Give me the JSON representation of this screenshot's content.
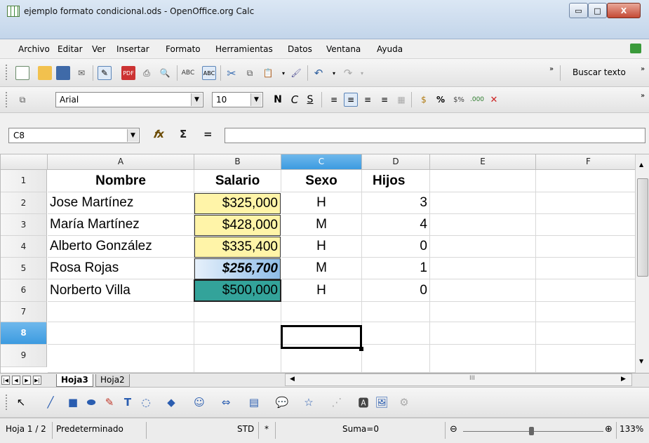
{
  "window": {
    "title": "ejemplo formato condicional.ods - OpenOffice.org Calc",
    "minimize": "▭",
    "maximize": "□",
    "close": "X"
  },
  "menu": [
    "Archivo",
    "Editar",
    "Ver",
    "Insertar",
    "Formato",
    "Herramientas",
    "Datos",
    "Ventana",
    "Ayuda"
  ],
  "toolbar": {
    "buscar_texto": "Buscar texto",
    "font_name": "Arial",
    "font_size": "10",
    "bold": "N",
    "italic": "C",
    "underline": "S",
    "percent": "%"
  },
  "formula_bar": {
    "cell_ref": "C8",
    "function_wizard": "𝒇x",
    "sum": "Σ",
    "equals": "=",
    "content": ""
  },
  "sheet": {
    "columns": [
      "A",
      "B",
      "C",
      "D",
      "E",
      "F"
    ],
    "rows": [
      "1",
      "2",
      "3",
      "4",
      "5",
      "6",
      "7",
      "8",
      "9"
    ],
    "selected_column": "C",
    "selected_row": "8",
    "header": [
      "Nombre",
      "Salario",
      "Sexo",
      "Hijos"
    ],
    "data": [
      {
        "nombre": "Jose Martínez",
        "salario": "$325,000",
        "sexo": "H",
        "hijos": "3"
      },
      {
        "nombre": "María Martínez",
        "salario": "$428,000",
        "sexo": "M",
        "hijos": "4"
      },
      {
        "nombre": "Alberto González",
        "salario": "$335,400",
        "sexo": "H",
        "hijos": "0"
      },
      {
        "nombre": "Rosa Rojas",
        "salario": "$256,700",
        "sexo": "M",
        "hijos": "1"
      },
      {
        "nombre": "Norberto Villa",
        "salario": "$500,000",
        "sexo": "H",
        "hijos": "0"
      }
    ]
  },
  "tabs": {
    "active": "Hoja3",
    "other": "Hoja2"
  },
  "status": {
    "sheet": "Hoja 1 / 2",
    "style": "Predeterminado",
    "mode": "STD",
    "modified": "*",
    "sum": "Suma=0",
    "zoom": "133%"
  },
  "colors": {
    "yellow_fill": "#fff4a8",
    "blue_fill": "#8fbde8",
    "teal_fill": "#33a39a",
    "selection": "#3c9be0"
  }
}
